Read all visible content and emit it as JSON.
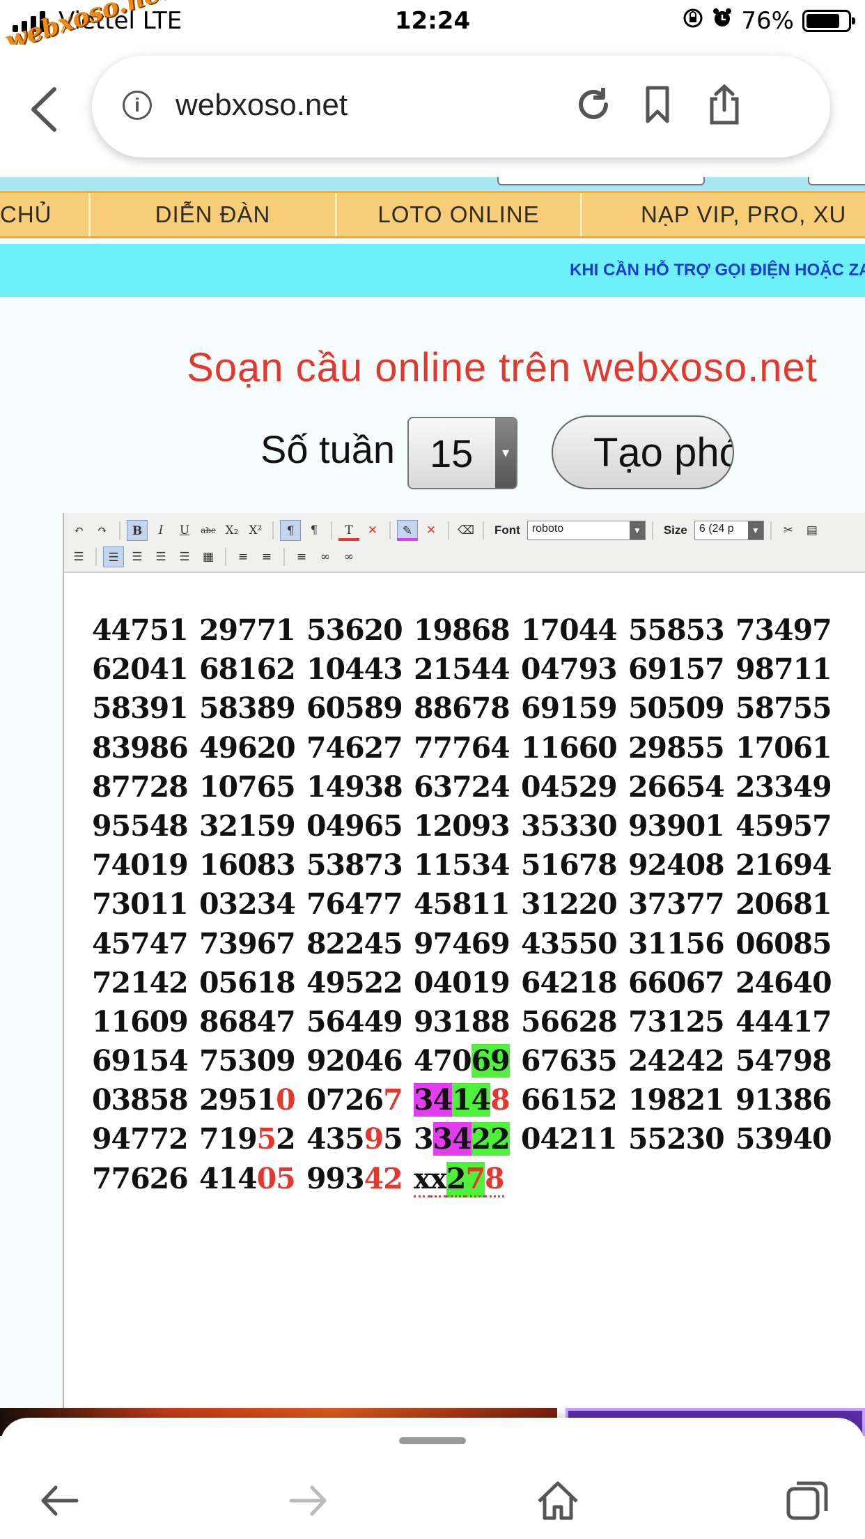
{
  "status_bar": {
    "carrier": "Viettel LTE",
    "time": "12:24",
    "battery": "76%",
    "watermark": "webxoso.net"
  },
  "browser": {
    "url": "webxoso.net",
    "icons": [
      "back-icon",
      "info-icon",
      "reload-icon",
      "bookmark-icon",
      "share-icon"
    ]
  },
  "nav": {
    "items": [
      "CHỦ",
      "DIỄN ĐÀN",
      "LOTO ONLINE",
      "NẠP VIP, PRO, XU"
    ]
  },
  "marquee_text": "KHI CẦN HỖ TRỢ GỌI ĐIỆN HOẶC ZA",
  "main": {
    "title": "Soạn cầu online trên webxoso.net",
    "weeks_label": "Số tuần",
    "weeks_value": "15",
    "create_button": "Tạo phó"
  },
  "editor_toolbar": {
    "font_label": "Font",
    "font_value": "roboto",
    "size_label": "Size",
    "size_value": "6 (24 p"
  },
  "number_rows": [
    [
      "44751",
      "29771",
      "53620",
      "19868",
      "17044",
      "55853",
      "73497"
    ],
    [
      "62041",
      "68162",
      "10443",
      "21544",
      "04793",
      "69157",
      "98711"
    ],
    [
      "58391",
      "58389",
      "60589",
      "88678",
      "69159",
      "50509",
      "58755"
    ],
    [
      "83986",
      "49620",
      "74627",
      "77764",
      "11660",
      "29855",
      "17061"
    ],
    [
      "87728",
      "10765",
      "14938",
      "63724",
      "04529",
      "26654",
      "23349"
    ],
    [
      "95548",
      "32159",
      "04965",
      "12093",
      "35330",
      "93901",
      "45957"
    ],
    [
      "74019",
      "16083",
      "53873",
      "11534",
      "51678",
      "92408",
      "21694"
    ],
    [
      "73011",
      "03234",
      "76477",
      "45811",
      "31220",
      "37377",
      "20681"
    ],
    [
      "45747",
      "73967",
      "82245",
      "97469",
      "43550",
      "31156",
      "06085"
    ],
    [
      "72142",
      "05618",
      "49522",
      "04019",
      "64218",
      "66067",
      "24640"
    ],
    [
      "11609",
      "86847",
      "56449",
      "93188",
      "56628",
      "73125",
      "44417"
    ],
    [
      "69154",
      "75309",
      "92046",
      "47069",
      "67635",
      "24242",
      "54798"
    ],
    [
      "03858",
      "29510",
      "07267",
      "34148",
      "66152",
      "19821",
      "91386"
    ],
    [
      "94772",
      "71952",
      "43595",
      "33422",
      "04211",
      "55230",
      "53940"
    ],
    [
      "77626",
      "41405",
      "99342",
      "xx278"
    ]
  ],
  "colors": {
    "title_red": "#e4372d",
    "nav_bg": "#f7cd78",
    "marquee_bg": "#6df0f7",
    "highlight_green": "#4ef23a",
    "highlight_magenta": "#e23ef0"
  }
}
